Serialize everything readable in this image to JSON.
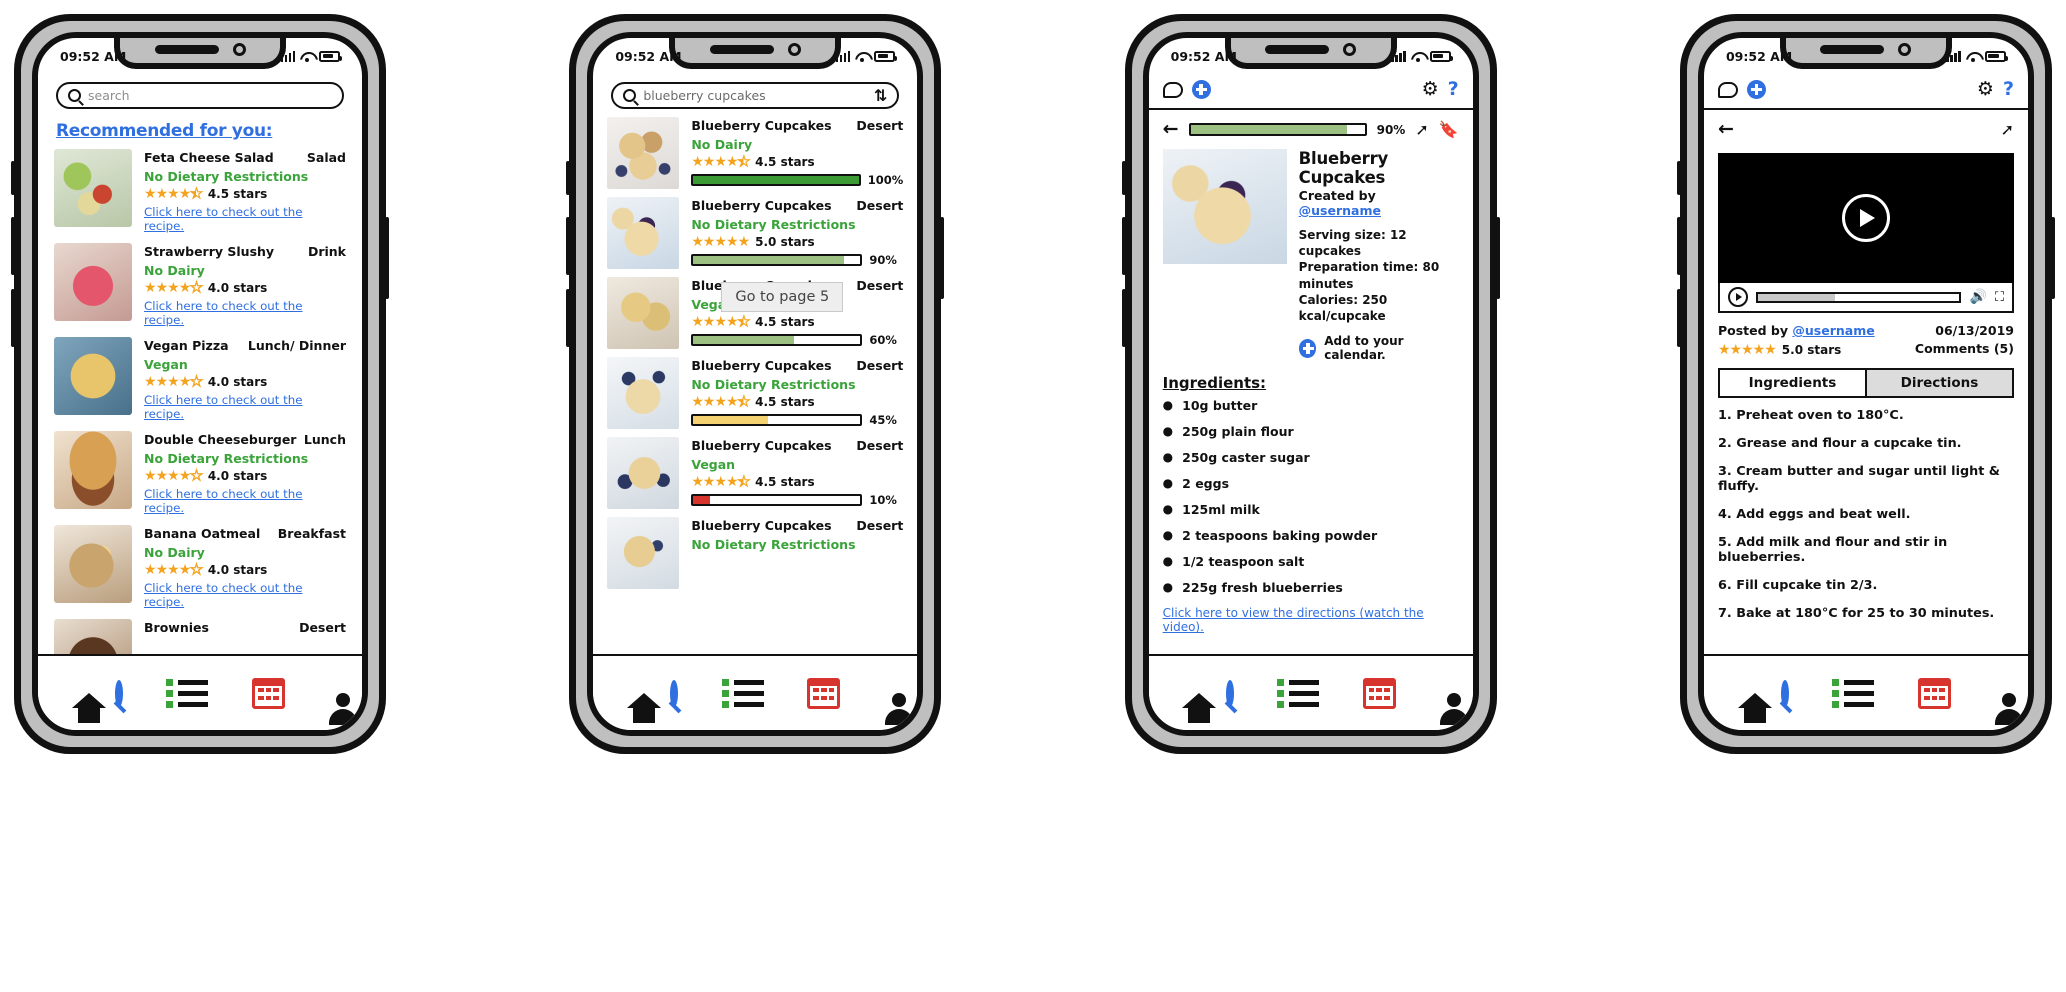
{
  "status_bar": {
    "time": "09:52 AM"
  },
  "screen1": {
    "search": {
      "placeholder": "search",
      "value": ""
    },
    "section_title": "Recommended for you:",
    "link_text": "Click here to check out the recipe.",
    "items": [
      {
        "name": "Feta Cheese Salad",
        "meal": "Salad",
        "diet": "No Dietary Restrictions",
        "rating": "4.5 stars",
        "stars": 4.5
      },
      {
        "name": "Strawberry Slushy",
        "meal": "Drink",
        "diet": "No Dairy",
        "rating": "4.0 stars",
        "stars": 4.0
      },
      {
        "name": "Vegan Pizza",
        "meal": "Lunch/ Dinner",
        "diet": "Vegan",
        "rating": "4.0 stars",
        "stars": 4.0
      },
      {
        "name": "Double Cheeseburger",
        "meal": "Lunch",
        "diet": "No Dietary Restrictions",
        "rating": "4.0 stars",
        "stars": 4.0
      },
      {
        "name": "Banana Oatmeal",
        "meal": "Breakfast",
        "diet": "No Dairy",
        "rating": "4.0 stars",
        "stars": 4.0
      },
      {
        "name": "Brownies",
        "meal": "Desert",
        "diet": "",
        "rating": "",
        "stars": 0
      }
    ]
  },
  "screen2": {
    "search": {
      "placeholder": "search",
      "value": "blueberry cupcakes"
    },
    "sort_icon": "sort-icon",
    "tooltip": "Go to page 5",
    "results": [
      {
        "name": "Blueberry Cupcakes",
        "meal": "Desert",
        "diet": "No Dairy",
        "rating": "4.5 stars",
        "stars": 4.5,
        "match": "100%",
        "match_value": 100,
        "bar_color": "#3c9a35"
      },
      {
        "name": "Blueberry Cupcakes",
        "meal": "Desert",
        "diet": "No Dietary Restrictions",
        "rating": "5.0 stars",
        "stars": 5.0,
        "match": "90%",
        "match_value": 90,
        "bar_color": "#9dc183"
      },
      {
        "name": "Blueberry Cupcakes",
        "meal": "Desert",
        "diet": "Vegan",
        "rating": "4.5 stars",
        "stars": 4.5,
        "match": "60%",
        "match_value": 60,
        "bar_color": "#9dc183"
      },
      {
        "name": "Blueberry Cupcakes",
        "meal": "Desert",
        "diet": "No Dietary Restrictions",
        "rating": "4.5 stars",
        "stars": 4.5,
        "match": "45%",
        "match_value": 45,
        "bar_color": "#f5d271"
      },
      {
        "name": "Blueberry Cupcakes",
        "meal": "Desert",
        "diet": "Vegan",
        "rating": "4.5 stars",
        "stars": 4.5,
        "match": "10%",
        "match_value": 10,
        "bar_color": "#d6342c"
      },
      {
        "name": "Blueberry Cupcakes",
        "meal": "Desert",
        "diet": "No Dietary Restrictions",
        "rating": "",
        "stars": 0,
        "match": "",
        "match_value": 0,
        "bar_color": "#3c9a35"
      }
    ]
  },
  "screen3": {
    "download_pct": "90%",
    "download_value": 90,
    "title": "Blueberry Cupcakes",
    "created_by_label": "Created by ",
    "author": "@username",
    "serving_size": "Serving size: 12 cupcakes",
    "prep_time": "Preparation time: 80 minutes",
    "calories": "Calories: 250 kcal/cupcake",
    "add_calendar": "Add to your calendar.",
    "ingredients_title": "Ingredients:",
    "ingredients": [
      "10g butter",
      "250g plain flour",
      "250g caster sugar",
      "2 eggs",
      "125ml milk",
      "2 teaspoons baking powder",
      "1/2 teaspoon salt",
      "225g fresh blueberries"
    ],
    "directions_link": "Click here to view the directions (watch the video)."
  },
  "screen4": {
    "posted_by_label": "Posted by ",
    "author": "@username",
    "date": "06/13/2019",
    "rating": "5.0 stars",
    "stars": 5.0,
    "comments": "Comments (5)",
    "tabs": [
      {
        "label": "Ingredients",
        "active": false
      },
      {
        "label": "Directions",
        "active": true
      }
    ],
    "steps": [
      "1. Preheat oven to 180°C.",
      "2. Grease and flour a cupcake tin.",
      "3. Cream butter and sugar until light & fluffy.",
      "4. Add eggs and beat well.",
      "5. Add milk and flour and stir in blueberries.",
      "6. Fill cupcake tin 2/3.",
      "7. Bake at 180°C for 25 to 30 minutes."
    ],
    "video_progress": 38
  },
  "bottom_nav": [
    {
      "icon": "home-icon",
      "label": "Home"
    },
    {
      "icon": "search-icon",
      "label": "Search"
    },
    {
      "icon": "list-icon",
      "label": "Lists"
    },
    {
      "icon": "calendar-icon",
      "label": "Calendar"
    },
    {
      "icon": "profile-icon",
      "label": "Profile"
    }
  ],
  "colors": {
    "accent": "#2f6fe0",
    "green": "#3aa33a",
    "star": "#f3a31e",
    "red": "#d6342c"
  }
}
